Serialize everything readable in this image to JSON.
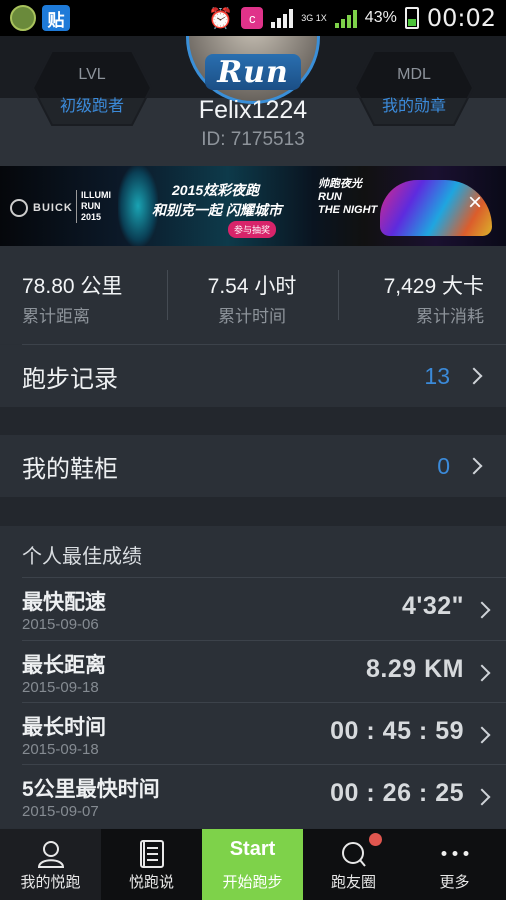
{
  "status_bar": {
    "left_app_icons": [
      "app-icon",
      "tieba-icon"
    ],
    "tieba_glyph": "贴",
    "network": "3G 1X",
    "battery_percent": "43%",
    "time": "00:02"
  },
  "profile": {
    "run_badge": "Run",
    "level_badge": {
      "top": "LVL",
      "bottom": "初级跑者"
    },
    "medal_badge": {
      "top": "MDL",
      "bottom": "我的勋章"
    },
    "username": "Felix1224",
    "user_id": "ID: 7175513"
  },
  "banner": {
    "brand": "BUICK",
    "illumi": [
      "ILLUMI",
      "RUN",
      "2015"
    ],
    "title": "2015炫彩夜跑",
    "subtitle": "和别克一起  闪耀城市",
    "button": "参与抽奖",
    "slogan": [
      "帅跑夜光",
      "RUN",
      "THE NIGHT"
    ],
    "close": "×"
  },
  "stats": [
    {
      "value": "78.80 公里",
      "label": "累计距离"
    },
    {
      "value": "7.54 小时",
      "label": "累计时间"
    },
    {
      "value": "7,429 大卡",
      "label": "累计消耗"
    }
  ],
  "records": {
    "label": "跑步记录",
    "count": "13"
  },
  "shoes": {
    "label": "我的鞋柜",
    "count": "0"
  },
  "personal_best": {
    "heading": "个人最佳成绩",
    "items": [
      {
        "name": "最快配速",
        "date": "2015-09-06",
        "value": "4'32\""
      },
      {
        "name": "最长距离",
        "date": "2015-09-18",
        "value": "8.29 KM"
      },
      {
        "name": "最长时间",
        "date": "2015-09-18",
        "value": "00 : 45 : 59"
      },
      {
        "name": "5公里最快时间",
        "date": "2015-09-07",
        "value": "00 : 26 : 25"
      }
    ]
  },
  "nav": {
    "my": "我的悦跑",
    "talk": "悦跑说",
    "start_en": "Start",
    "start_cn": "开始跑步",
    "friends": "跑友圈",
    "more": "更多"
  },
  "colors": {
    "accent": "#3b8ad9",
    "start": "#7ed24a",
    "notification": "#e0564f"
  }
}
